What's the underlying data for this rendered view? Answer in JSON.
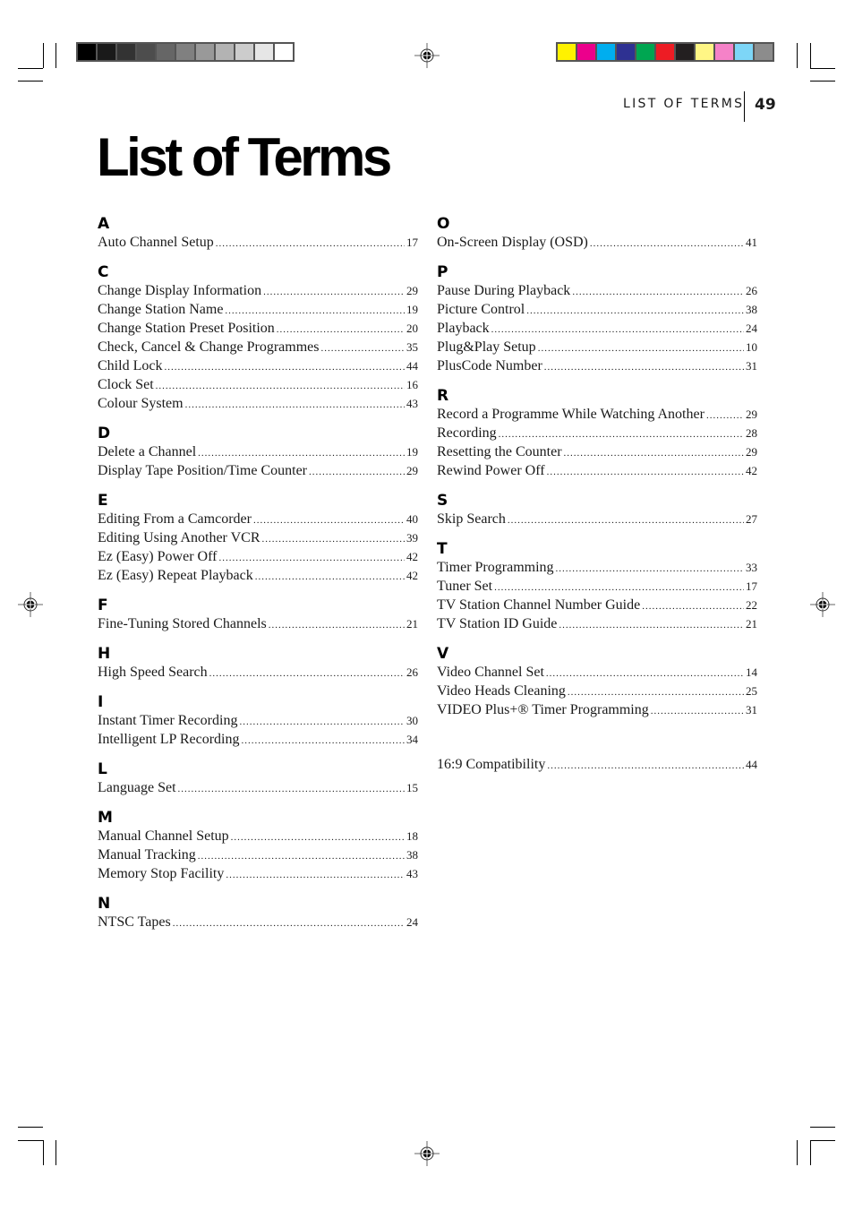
{
  "header": {
    "running_head": "LIST OF TERMS",
    "page_number": "49"
  },
  "title": "List of Terms",
  "print_marks": {
    "grayscale_swatches": [
      "#000000",
      "#1a1a1a",
      "#333333",
      "#4d4d4d",
      "#666666",
      "#808080",
      "#999999",
      "#b3b3b3",
      "#cccccc",
      "#e6e6e6",
      "#ffffff"
    ],
    "color_swatches": [
      "#fff200",
      "#ec008c",
      "#00aeef",
      "#2e3192",
      "#00a651",
      "#ed1c24",
      "#231f20",
      "#fff685",
      "#f582c8",
      "#7dd6f7",
      "#8c8c8c"
    ]
  },
  "index": {
    "left": [
      {
        "letter": "A",
        "entries": [
          {
            "term": "Auto Channel Setup",
            "page": "17"
          }
        ]
      },
      {
        "letter": "C",
        "entries": [
          {
            "term": "Change Display Information",
            "page": "29"
          },
          {
            "term": "Change Station Name",
            "page": "19"
          },
          {
            "term": "Change Station Preset Position",
            "page": "20"
          },
          {
            "term": "Check, Cancel & Change Programmes",
            "page": "35"
          },
          {
            "term": "Child Lock",
            "page": "44"
          },
          {
            "term": "Clock Set",
            "page": "16"
          },
          {
            "term": "Colour System",
            "page": "43"
          }
        ]
      },
      {
        "letter": "D",
        "entries": [
          {
            "term": "Delete a Channel",
            "page": "19"
          },
          {
            "term": "Display Tape Position/Time Counter",
            "page": "29"
          }
        ]
      },
      {
        "letter": "E",
        "entries": [
          {
            "term": "Editing From a Camcorder",
            "page": "40"
          },
          {
            "term": "Editing Using Another VCR",
            "page": "39"
          },
          {
            "term": "Ez (Easy) Power Off",
            "page": "42"
          },
          {
            "term": "Ez (Easy) Repeat Playback",
            "page": "42"
          }
        ]
      },
      {
        "letter": "F",
        "entries": [
          {
            "term": "Fine-Tuning Stored Channels",
            "page": "21"
          }
        ]
      },
      {
        "letter": "H",
        "entries": [
          {
            "term": "High Speed Search",
            "page": "26"
          }
        ]
      },
      {
        "letter": "I",
        "entries": [
          {
            "term": "Instant Timer Recording",
            "page": "30"
          },
          {
            "term": "Intelligent LP Recording",
            "page": "34"
          }
        ]
      },
      {
        "letter": "L",
        "entries": [
          {
            "term": "Language Set",
            "page": "15"
          }
        ]
      },
      {
        "letter": "M",
        "entries": [
          {
            "term": "Manual Channel Setup",
            "page": "18"
          },
          {
            "term": "Manual Tracking",
            "page": "38"
          },
          {
            "term": "Memory Stop Facility",
            "page": "43"
          }
        ]
      },
      {
        "letter": "N",
        "entries": [
          {
            "term": "NTSC Tapes",
            "page": "24"
          }
        ]
      }
    ],
    "right": [
      {
        "letter": "O",
        "entries": [
          {
            "term": "On-Screen Display (OSD)",
            "page": "41"
          }
        ]
      },
      {
        "letter": "P",
        "entries": [
          {
            "term": "Pause During Playback",
            "page": "26"
          },
          {
            "term": "Picture Control",
            "page": "38"
          },
          {
            "term": "Playback",
            "page": "24"
          },
          {
            "term": "Plug&Play Setup",
            "page": "10"
          },
          {
            "term": "PlusCode Number",
            "page": "31"
          }
        ]
      },
      {
        "letter": "R",
        "entries": [
          {
            "term": "Record a Programme While Watching Another",
            "page": "29"
          },
          {
            "term": "Recording",
            "page": "28"
          },
          {
            "term": "Resetting the Counter",
            "page": "29"
          },
          {
            "term": "Rewind Power Off",
            "page": "42"
          }
        ]
      },
      {
        "letter": "S",
        "entries": [
          {
            "term": "Skip Search",
            "page": "27"
          }
        ]
      },
      {
        "letter": "T",
        "entries": [
          {
            "term": "Timer Programming",
            "page": "33"
          },
          {
            "term": "Tuner Set",
            "page": "17"
          },
          {
            "term": "TV Station Channel Number Guide",
            "page": "22"
          },
          {
            "term": "TV Station ID Guide",
            "page": "21"
          }
        ]
      },
      {
        "letter": "V",
        "entries": [
          {
            "term": "Video Channel Set",
            "page": "14"
          },
          {
            "term": "Video Heads Cleaning",
            "page": "25"
          },
          {
            "term": "VIDEO Plus+® Timer Programming",
            "page": "31"
          }
        ]
      },
      {
        "letter": "",
        "entries": [
          {
            "term": "16:9 Compatibility",
            "page": "44"
          }
        ]
      }
    ]
  }
}
